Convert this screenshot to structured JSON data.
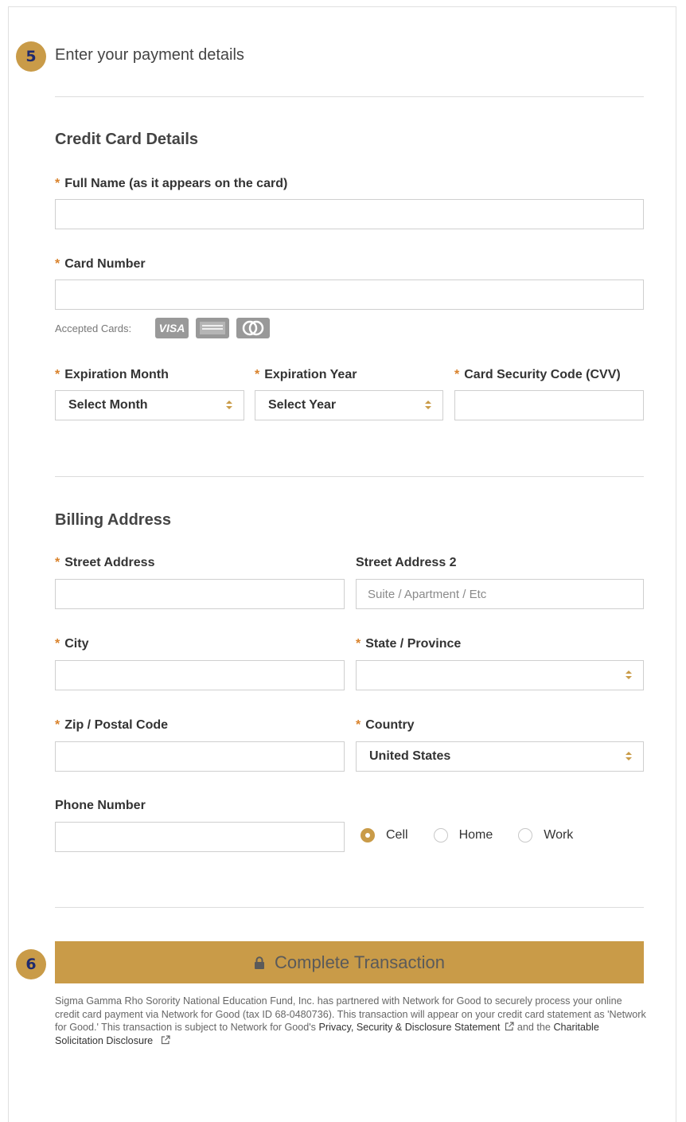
{
  "steps": {
    "payment_step": "5",
    "complete_step": "6"
  },
  "payment": {
    "title": "Enter your payment details"
  },
  "credit_card": {
    "heading": "Credit Card Details",
    "full_name_label": "Full Name (as it appears on the card)",
    "full_name_value": "",
    "card_number_label": "Card Number",
    "card_number_value": "",
    "accepted_cards_label": "Accepted Cards:",
    "accepted_cards": [
      "visa-icon",
      "amex-icon",
      "mastercard-icon"
    ],
    "visa_text": "VISA",
    "exp_month_label": "Expiration Month",
    "exp_month_value": "Select Month",
    "exp_year_label": "Expiration Year",
    "exp_year_value": "Select Year",
    "cvv_label": "Card Security Code (CVV)",
    "cvv_value": ""
  },
  "billing": {
    "heading": "Billing Address",
    "street_label": "Street Address",
    "street2_label": "Street Address 2",
    "street2_placeholder": "Suite / Apartment / Etc",
    "city_label": "City",
    "state_label": "State / Province",
    "state_value": "",
    "zip_label": "Zip / Postal Code",
    "country_label": "Country",
    "country_value": "United States",
    "phone_label": "Phone Number",
    "phone_types": [
      {
        "label": "Cell",
        "selected": true
      },
      {
        "label": "Home",
        "selected": false
      },
      {
        "label": "Work",
        "selected": false
      }
    ]
  },
  "required_marker": "*",
  "submit": {
    "label": "Complete Transaction",
    "icon": "lock-icon"
  },
  "disclaimer": {
    "text": "Sigma Gamma Rho Sorority National Education Fund, Inc. has partnered with Network for Good to securely process your online credit card payment via Network for Good (tax ID 68-0480736). This transaction will appear on your credit card statement as 'Network for Good.' This transaction is subject to Network for Good's ",
    "privacy_link": "Privacy, Security & Disclosure Statement",
    "and_text": " and the ",
    "charitable_link": "Charitable Solicitation Disclosure"
  },
  "colors": {
    "accent": "#c99b48",
    "badge_text": "#1f2a6e",
    "required": "#d9822b"
  }
}
